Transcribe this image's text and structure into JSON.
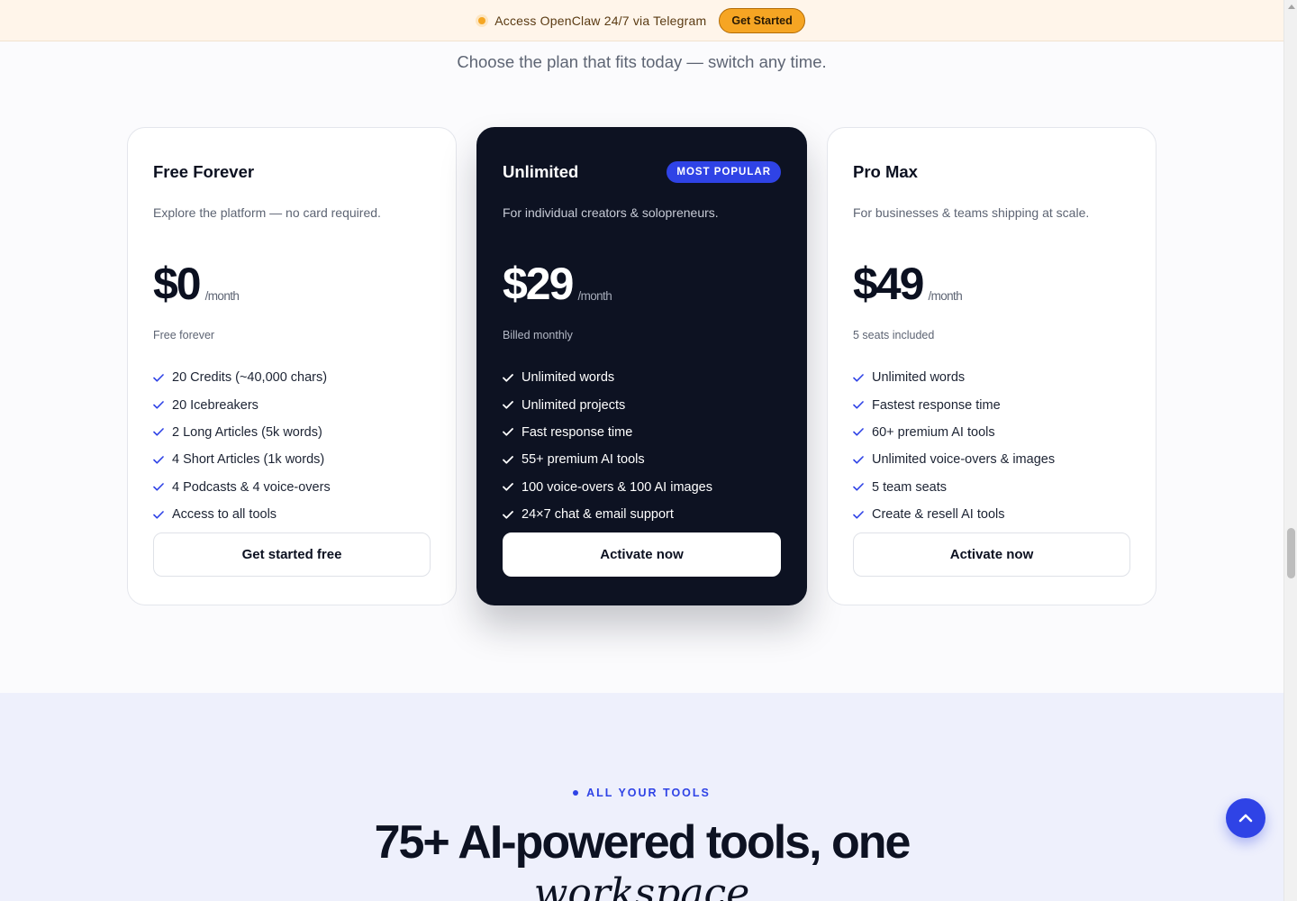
{
  "announcement": {
    "message": "Access OpenClaw 24/7 via Telegram",
    "cta": "Get Started"
  },
  "pricing": {
    "subtitle": "Choose the plan that fits today — switch any time.",
    "plans": [
      {
        "name": "Free Forever",
        "description": "Explore the platform — no card required.",
        "price": "$0",
        "period": "/month",
        "note": "Free forever",
        "features": [
          "20 Credits (~40,000 chars)",
          "20 Icebreakers",
          "2 Long Articles (5k words)",
          "4 Short Articles (1k words)",
          "4 Podcasts & 4 voice-overs",
          "Access to all tools"
        ],
        "button": "Get started free"
      },
      {
        "name": "Unlimited",
        "badge": "MOST POPULAR",
        "description": "For individual creators & solopreneurs.",
        "price": "$29",
        "period": "/month",
        "note": "Billed monthly",
        "features": [
          "Unlimited words",
          "Unlimited projects",
          "Fast response time",
          "55+ premium AI tools",
          "100 voice-overs & 100 AI images",
          "24×7 chat & email support"
        ],
        "button": "Activate now"
      },
      {
        "name": "Pro Max",
        "description": "For businesses & teams shipping at scale.",
        "price": "$49",
        "period": "/month",
        "note": "5 seats included",
        "features": [
          "Unlimited words",
          "Fastest response time",
          "60+ premium AI tools",
          "Unlimited voice-overs & images",
          "5 team seats",
          "Create & resell AI tools"
        ],
        "button": "Activate now"
      }
    ]
  },
  "tools_section": {
    "eyebrow": "ALL YOUR TOOLS",
    "title_line1": "75+ AI-powered tools, one",
    "title_line2": "workspace"
  },
  "icons": {
    "check": "check-icon",
    "scroll_top": "chevron-up-icon"
  },
  "colors": {
    "accent": "#2f43e6",
    "dark_card": "#0d1222",
    "announcement_bg": "#fff5ea",
    "cta_bg": "#f6a523",
    "tools_bg": "#eef0fc"
  }
}
